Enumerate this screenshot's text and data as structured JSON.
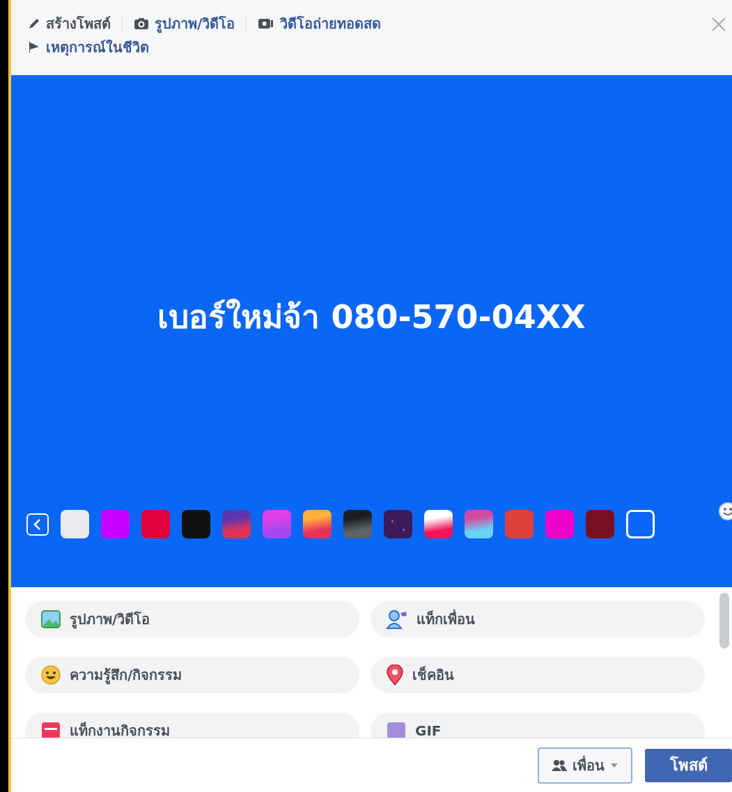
{
  "tabs": [
    {
      "kind": "pencil",
      "label": "สร้างโพสต์",
      "selected": true
    },
    {
      "kind": "camera",
      "label": "รูปภาพ/วิดีโอ",
      "selected": false
    },
    {
      "kind": "video",
      "label": "วิดีโอถ่ายทอดสด",
      "selected": false
    },
    {
      "kind": "flag",
      "label": "เหตุการณ์ในชีวิต",
      "selected": false
    }
  ],
  "post_text": "เบอร์ใหม่จ้า 080-570-04XX",
  "backgrounds": [
    {
      "kind": "solid",
      "color": "#e9eaed"
    },
    {
      "kind": "solid",
      "color": "#c600ff"
    },
    {
      "kind": "solid",
      "color": "#e2013b"
    },
    {
      "kind": "solid",
      "color": "#111111"
    },
    {
      "kind": "gradient",
      "stops": [
        {
          "color": "#5c35b0"
        },
        {
          "color": "#e2325a"
        }
      ]
    },
    {
      "kind": "gradient",
      "stops": [
        {
          "color": "#e040e8"
        },
        {
          "color": "#a548f0"
        }
      ]
    },
    {
      "kind": "gradient",
      "stops": [
        {
          "color": "#ffb13a"
        },
        {
          "color": "#e8305d"
        }
      ]
    },
    {
      "kind": "gradient",
      "stops": [
        {
          "color": "#1c1e21"
        },
        {
          "color": "#5e636a"
        }
      ]
    },
    {
      "kind": "pattern",
      "color": "#3d1a5b"
    },
    {
      "kind": "gradient",
      "stops": [
        {
          "color": "#ffffff"
        },
        {
          "color": "#f0145a"
        }
      ]
    },
    {
      "kind": "gradient",
      "stops": [
        {
          "color": "#d04b9f"
        },
        {
          "color": "#6ad2fa"
        }
      ]
    },
    {
      "kind": "solid",
      "color": "#e0413d"
    },
    {
      "kind": "solid",
      "color": "#ee00c8"
    },
    {
      "kind": "solid",
      "color": "#7a1123"
    },
    {
      "kind": "outline",
      "color": "#ffffff"
    }
  ],
  "options": [
    {
      "kind": "photo",
      "label": "รูปภาพ/วิดีโอ"
    },
    {
      "kind": "tag",
      "label": "แท็กเพื่อน"
    },
    {
      "kind": "feeling",
      "label": "ความรู้สึก/กิจกรรม"
    },
    {
      "kind": "checkin",
      "label": "เช็คอิน"
    },
    {
      "kind": "event",
      "label": "แท็กงานกิจกรรม"
    },
    {
      "kind": "gif",
      "label": "GIF"
    }
  ],
  "audience_button": "เพื่อน",
  "post_button": "โพสต์"
}
